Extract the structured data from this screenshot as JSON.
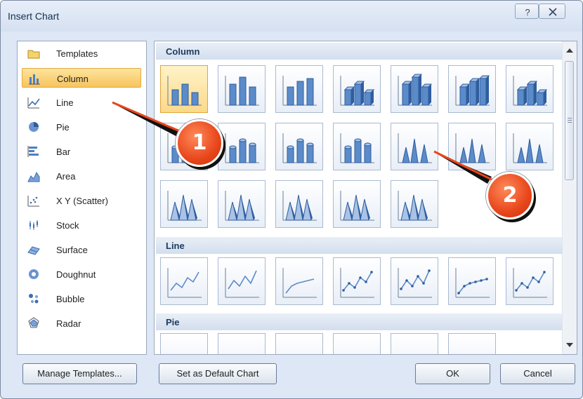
{
  "window": {
    "title": "Insert Chart",
    "help_glyph": "?",
    "close_glyph": "X"
  },
  "chart_types": [
    {
      "label": "Templates",
      "icon": "folder-icon"
    },
    {
      "label": "Column",
      "icon": "column-chart-icon",
      "selected": true
    },
    {
      "label": "Line",
      "icon": "line-chart-icon"
    },
    {
      "label": "Pie",
      "icon": "pie-chart-icon"
    },
    {
      "label": "Bar",
      "icon": "bar-chart-icon"
    },
    {
      "label": "Area",
      "icon": "area-chart-icon"
    },
    {
      "label": "X Y (Scatter)",
      "icon": "scatter-chart-icon"
    },
    {
      "label": "Stock",
      "icon": "stock-chart-icon"
    },
    {
      "label": "Surface",
      "icon": "surface-chart-icon"
    },
    {
      "label": "Doughnut",
      "icon": "doughnut-chart-icon"
    },
    {
      "label": "Bubble",
      "icon": "bubble-chart-icon"
    },
    {
      "label": "Radar",
      "icon": "radar-chart-icon"
    }
  ],
  "gallery": {
    "sections": [
      {
        "title": "Column",
        "tiles": 19
      },
      {
        "title": "Line",
        "tiles": 7
      },
      {
        "title": "Pie",
        "tiles": 6
      }
    ]
  },
  "buttons": {
    "manage_templates": "Manage Templates...",
    "set_default": "Set as Default Chart",
    "ok": "OK",
    "cancel": "Cancel"
  },
  "callouts": {
    "first": "1",
    "second": "2"
  },
  "colors": {
    "accent_orange": "#e8461b",
    "selection": "#f7c45d",
    "tile_blue": "#5b8bc9"
  }
}
